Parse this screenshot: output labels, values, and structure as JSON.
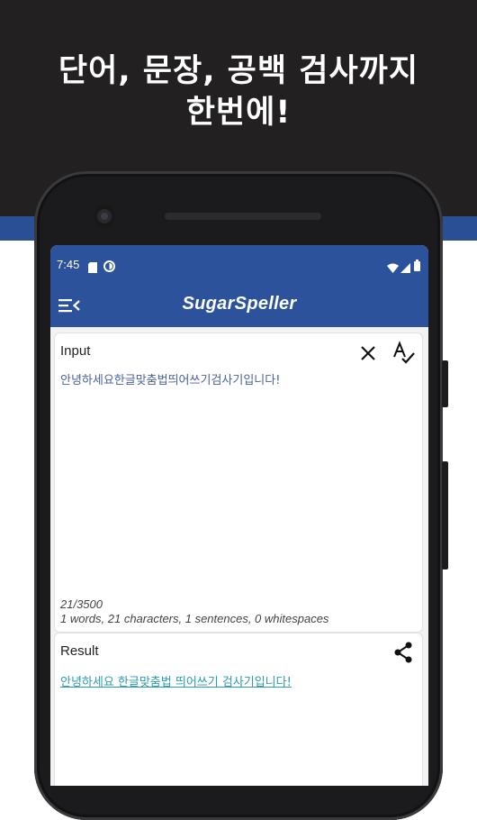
{
  "promo": {
    "headline_line1": "단어, 문장, 공백 검사까지",
    "headline_line2": "한번에!"
  },
  "colors": {
    "dark_background": "#232021",
    "brand_blue": "#2b529a",
    "link_teal": "#2a9bb0"
  },
  "statusbar": {
    "time": "7:45",
    "left_icons": [
      "sd-card-icon",
      "data-saver-icon"
    ],
    "right_icons": [
      "wifi-icon",
      "signal-icon",
      "battery-icon"
    ]
  },
  "appbar": {
    "title": "SugarSpeller",
    "menu_icon": "menu-collapse-icon"
  },
  "input_card": {
    "label": "Input",
    "clear_icon": "close-icon",
    "spellcheck_icon": "spellcheck-icon",
    "text": "안녕하세요한글맞춤법띄어쓰기검사기입니다!",
    "char_count": "21/3500",
    "stats": "1 words, 21 characters, 1 sentences, 0 whitespaces"
  },
  "result_card": {
    "label": "Result",
    "share_icon": "share-icon",
    "text": "안녕하세요 한글맞춤법 띄어쓰기 검사기입니다!"
  }
}
